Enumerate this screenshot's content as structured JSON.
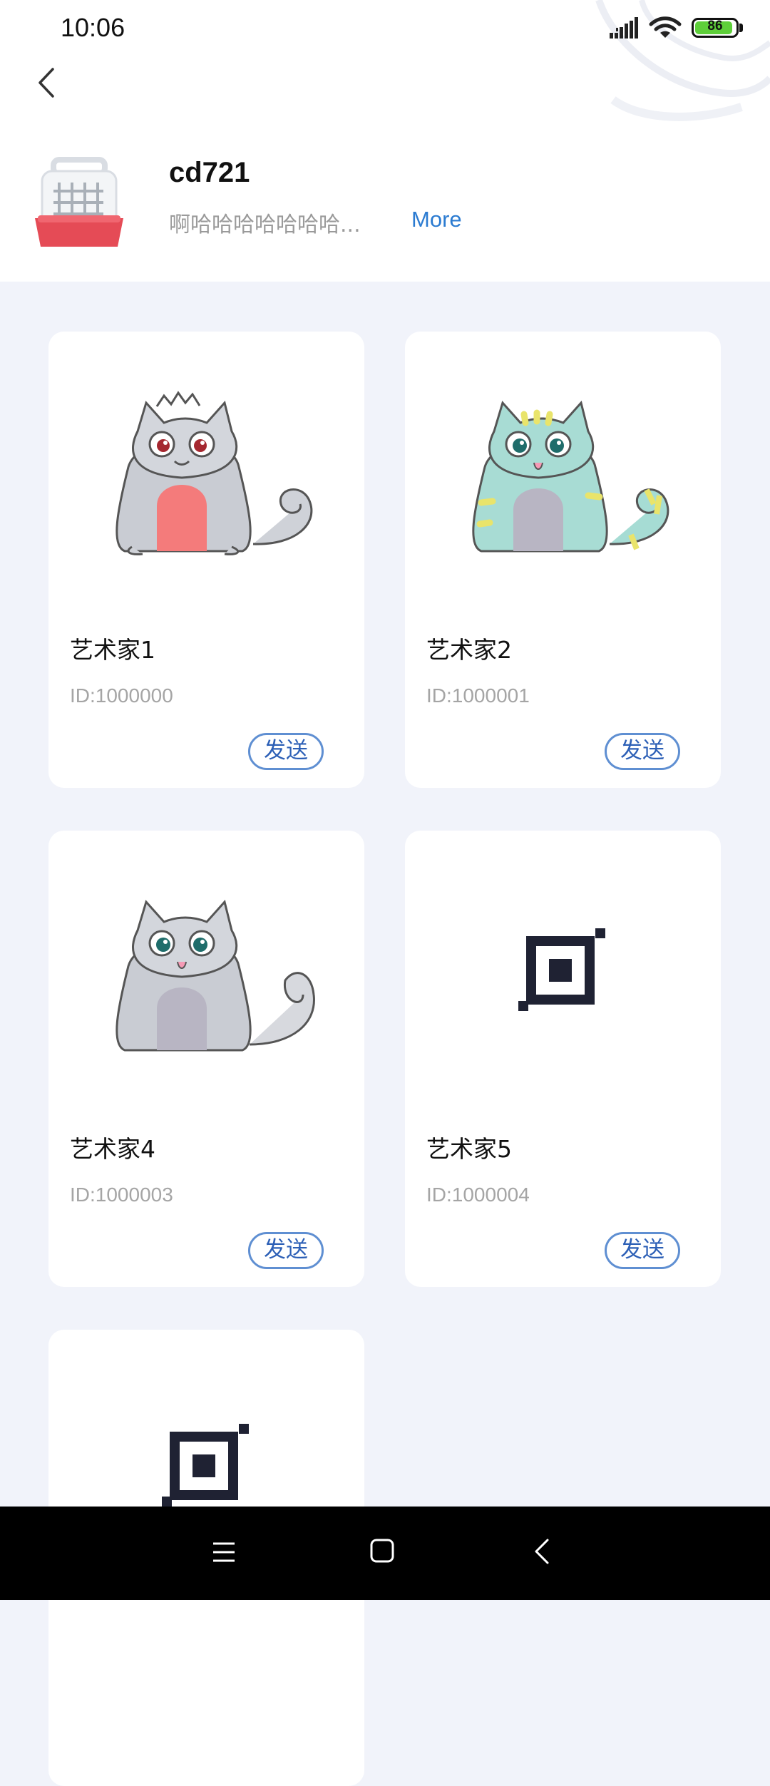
{
  "status_bar": {
    "time": "10:06",
    "battery_level": "86",
    "icons": [
      "signal-icon",
      "wifi-icon",
      "battery-icon"
    ]
  },
  "header": {
    "back_icon": "chevron-left-icon",
    "shop_icon": "pet-carrier-icon",
    "shop_name": "cd721",
    "description": "啊哈哈哈哈哈哈哈...",
    "more_label": "More"
  },
  "items": [
    {
      "name": "艺术家1",
      "id_text": "ID:1000000",
      "send_label": "发送",
      "image": "grey-cat-red-eyes"
    },
    {
      "name": "艺术家2",
      "id_text": "ID:1000001",
      "send_label": "发送",
      "image": "teal-striped-cat"
    },
    {
      "name": "艺术家4",
      "id_text": "ID:1000003",
      "send_label": "发送",
      "image": "grey-cat"
    },
    {
      "name": "艺术家5",
      "id_text": "ID:1000004",
      "send_label": "发送",
      "image": "placeholder-logo-icon"
    },
    {
      "name": "",
      "id_text": "",
      "send_label": "",
      "image": "placeholder-logo-icon"
    }
  ],
  "nav_bar": {
    "icons": [
      "menu-icon",
      "home-icon",
      "back-icon"
    ]
  },
  "colors": {
    "accent": "#2b7bd1",
    "send_button_border": "#5f8fd2",
    "page_background": "#f1f3fa",
    "nav_background": "#000000"
  }
}
